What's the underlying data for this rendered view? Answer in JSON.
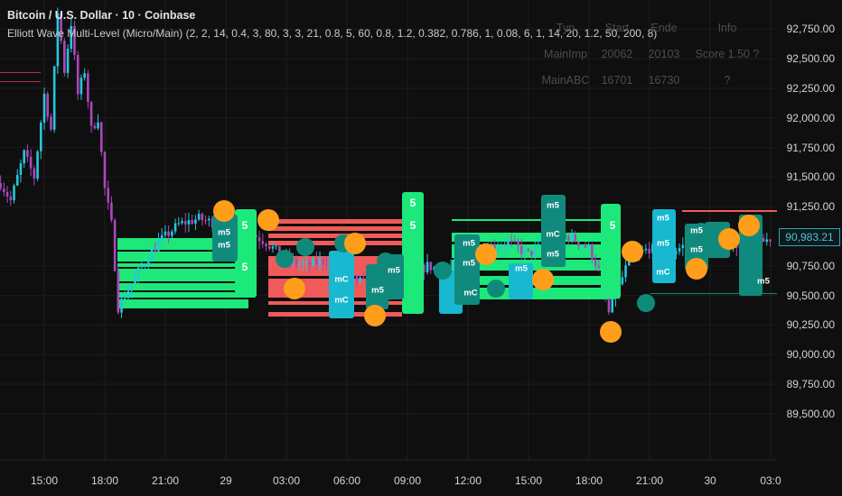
{
  "header": {
    "title": "Bitcoin / U.S. Dollar · 10 · Coinbase",
    "study": "Elliott Wave Multi-Level (Micro/Main) (2, 2, 14, 0.4, 3, 80, 3, 3, 21, 0.8, 5, 60, 0.8, 1.2, 0.382, 0.786, 1, 0.08, 6, 1, 14, 20, 1.2, 50, 200, 8)"
  },
  "info_table": {
    "headers": [
      "Typ",
      "Start",
      "Ende",
      "Info"
    ],
    "rows": [
      [
        "MainImp",
        "20062",
        "20103",
        "Score 1.50 ?"
      ],
      [
        "MainABC",
        "16701",
        "16730",
        "?"
      ]
    ]
  },
  "chart_data": {
    "type": "candlestick",
    "symbol": "BTC/USD",
    "interval_minutes": 10,
    "last_price": "90,983.21",
    "y_ticks": [
      "92,750.00",
      "92,500.00",
      "92,250.00",
      "92,000.00",
      "91,750.00",
      "91,500.00",
      "91,250.00",
      "90,750.00",
      "90,500.00",
      "90,250.00",
      "90,000.00",
      "89,750.00",
      "89,500.00"
    ],
    "x_ticks": [
      "15:00",
      "18:00",
      "21:00",
      "29",
      "03:00",
      "06:00",
      "09:00",
      "12:00",
      "15:00",
      "18:00",
      "21:00",
      "30",
      "03:0"
    ],
    "ylim": [
      89300,
      94750
    ],
    "price_path_bar_price": [
      [
        -13,
        91450
      ],
      [
        -10,
        91300
      ],
      [
        -6,
        91700
      ],
      [
        -3,
        91500
      ],
      [
        0,
        92200
      ],
      [
        2,
        91900
      ],
      [
        4,
        92900
      ],
      [
        6,
        92400
      ],
      [
        8,
        92800
      ],
      [
        10,
        92200
      ],
      [
        12,
        92400
      ],
      [
        14,
        91900
      ],
      [
        16,
        92000
      ],
      [
        18,
        91400
      ],
      [
        20,
        91100
      ],
      [
        22,
        90400
      ],
      [
        24,
        90500
      ],
      [
        28,
        90700
      ],
      [
        34,
        90950
      ],
      [
        40,
        91100
      ],
      [
        46,
        91150
      ],
      [
        52,
        91100
      ],
      [
        56,
        91000
      ],
      [
        60,
        91050
      ],
      [
        66,
        90950
      ],
      [
        72,
        90800
      ],
      [
        78,
        90750
      ],
      [
        84,
        90800
      ],
      [
        90,
        90650
      ],
      [
        96,
        90600
      ],
      [
        100,
        90450
      ],
      [
        104,
        90550
      ],
      [
        108,
        90650
      ],
      [
        114,
        90750
      ],
      [
        120,
        90700
      ],
      [
        126,
        90850
      ],
      [
        132,
        90900
      ],
      [
        138,
        90950
      ],
      [
        144,
        90850
      ],
      [
        150,
        90950
      ],
      [
        156,
        91000
      ],
      [
        162,
        90900
      ],
      [
        166,
        90650
      ],
      [
        168,
        90350
      ],
      [
        170,
        90500
      ],
      [
        174,
        90800
      ],
      [
        180,
        90900
      ],
      [
        186,
        90850
      ],
      [
        192,
        90950
      ],
      [
        198,
        90900
      ],
      [
        204,
        90950
      ],
      [
        210,
        90900
      ],
      [
        216,
        90983
      ]
    ],
    "wave_labels": [
      "m5",
      "m5",
      "5",
      "5",
      "mC",
      "mC",
      "m5",
      "m5",
      "5",
      "5",
      "m5",
      "m5",
      "mC",
      "m5",
      "m5",
      "mC",
      "m5",
      "5",
      "m5",
      "m5",
      "mC",
      "m5",
      "m5",
      "m5"
    ],
    "colors": {
      "up": "#26c6da",
      "down": "#ab47bc",
      "bull_zone": "#1de87a",
      "bear_zone": "#f05a5a",
      "pivot_high": "#ff9e1b",
      "pivot_low": "#0f8a7a",
      "label_teal": "#118a7e",
      "label_cyan": "#17b8d0"
    }
  }
}
